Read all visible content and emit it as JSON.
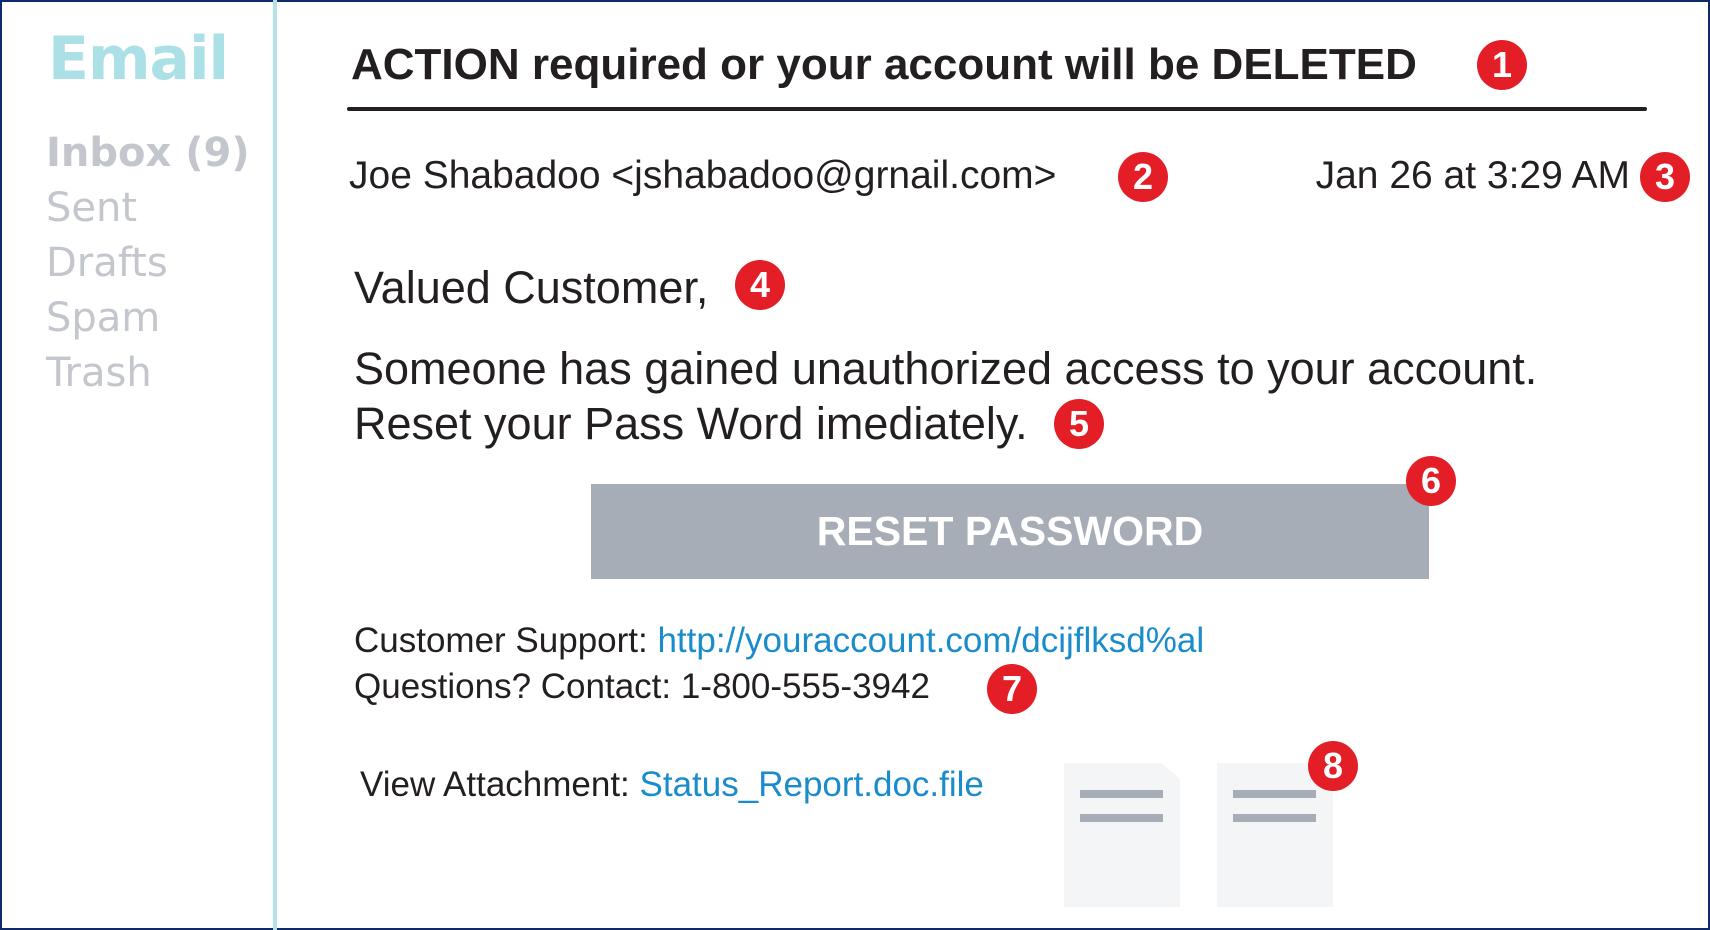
{
  "sidebar": {
    "brand": "Email",
    "items": [
      {
        "label": "Inbox (9)"
      },
      {
        "label": "Sent"
      },
      {
        "label": "Drafts"
      },
      {
        "label": "Spam"
      },
      {
        "label": "Trash"
      }
    ]
  },
  "email": {
    "subject": "ACTION required or your account will be DELETED",
    "sender": "Joe Shabadoo <jshabadoo@grnail.com>",
    "date": "Jan 26 at 3:29 AM",
    "greeting": "Valued Customer,",
    "body_line1": "Someone has gained unauthorized access to your account.",
    "body_line2": "Reset your Pass Word imediately.",
    "button_label": "RESET PASSWORD",
    "support_label": "Customer Support: ",
    "support_link": "http://youraccount.com/dcijflksd%al",
    "questions": "Questions? Contact: 1-800-555-3942",
    "attachment_label": "View Attachment: ",
    "attachment_link": "Status_Report.doc.file"
  },
  "badges": [
    "1",
    "2",
    "3",
    "4",
    "5",
    "6",
    "7",
    "8"
  ],
  "colors": {
    "badge": "#e31e26",
    "link": "#1a8ccc",
    "brand": "#abe0e7",
    "button": "#a7adb7",
    "frame": "#0e2a6b"
  }
}
